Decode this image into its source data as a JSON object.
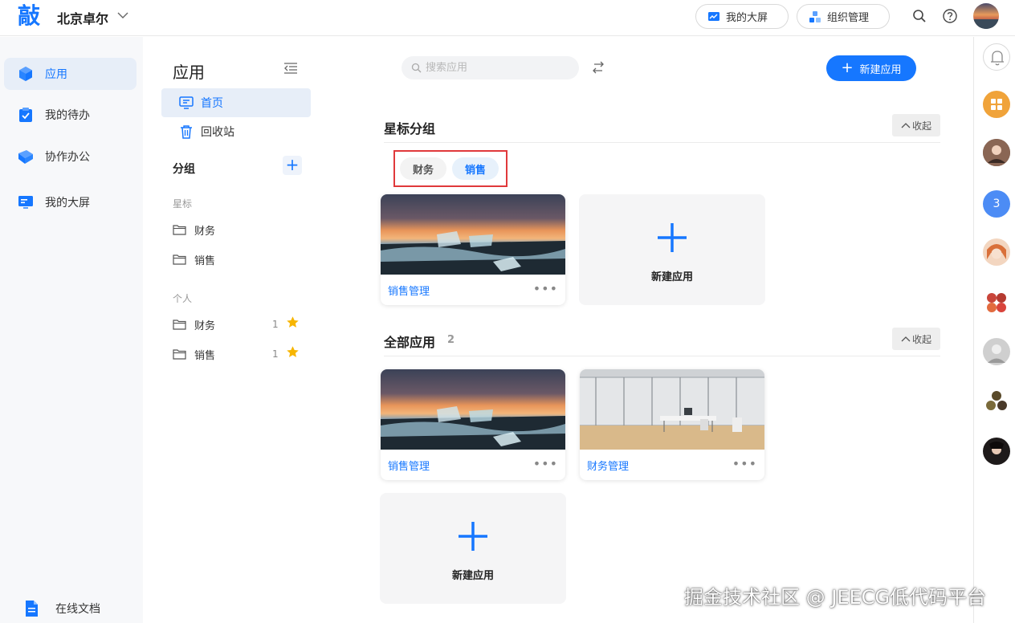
{
  "topbar": {
    "logo": "敲",
    "org_name": "北京卓尔",
    "big_screen_btn": "我的大屏",
    "org_manage_btn": "组织管理"
  },
  "leftnav": {
    "items": [
      {
        "label": "应用"
      },
      {
        "label": "我的待办"
      },
      {
        "label": "协作办公"
      },
      {
        "label": "我的大屏"
      }
    ],
    "bottom_item": "在线文档"
  },
  "panel": {
    "title": "应用",
    "nav": [
      {
        "label": "首页"
      },
      {
        "label": "回收站"
      }
    ],
    "group_label": "分组",
    "add_group": "+",
    "starred_label": "星标",
    "starred_folders": [
      {
        "label": "财务"
      },
      {
        "label": "销售"
      }
    ],
    "personal_label": "个人",
    "personal_folders": [
      {
        "label": "财务",
        "count": "1"
      },
      {
        "label": "销售",
        "count": "1"
      }
    ]
  },
  "main": {
    "search_placeholder": "搜索应用",
    "new_app_btn": "新建应用",
    "starred_section": {
      "title": "星标分组",
      "collapse": "收起",
      "tags": [
        "财务",
        "销售"
      ],
      "cards": [
        {
          "name": "销售管理"
        }
      ],
      "new_card_label": "新建应用"
    },
    "all_section": {
      "title": "全部应用",
      "count": "2",
      "collapse": "收起",
      "cards": [
        {
          "name": "销售管理"
        },
        {
          "name": "财务管理"
        }
      ],
      "new_card_label": "新建应用"
    }
  },
  "rightrail": {
    "badge_number": "3"
  },
  "watermark": "掘金技术社区 @ JEECG低代码平台",
  "colors": {
    "accent": "#1677ff",
    "highlight_border": "#e0393b",
    "rail_orange": "#f0a33a",
    "rail_blue": "#4c8cf5"
  }
}
